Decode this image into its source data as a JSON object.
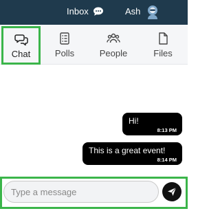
{
  "topbar": {
    "inbox_label": "Inbox",
    "user_name": "Ash"
  },
  "tabs": [
    {
      "label": "Chat",
      "icon": "chat-icon",
      "active": true
    },
    {
      "label": "Polls",
      "icon": "poll-list-icon",
      "active": false
    },
    {
      "label": "People",
      "icon": "people-icon",
      "active": false
    },
    {
      "label": "Files",
      "icon": "file-icon",
      "active": false
    }
  ],
  "messages": [
    {
      "text": "Hi!",
      "time": "8:13 PM"
    },
    {
      "text": "This is a great event!",
      "time": "8:14 PM"
    }
  ],
  "composer": {
    "placeholder": "Type a message",
    "value": ""
  },
  "colors": {
    "topbar": "#1f3a4d",
    "highlight": "#3bb54a",
    "bubble": "#000000"
  }
}
